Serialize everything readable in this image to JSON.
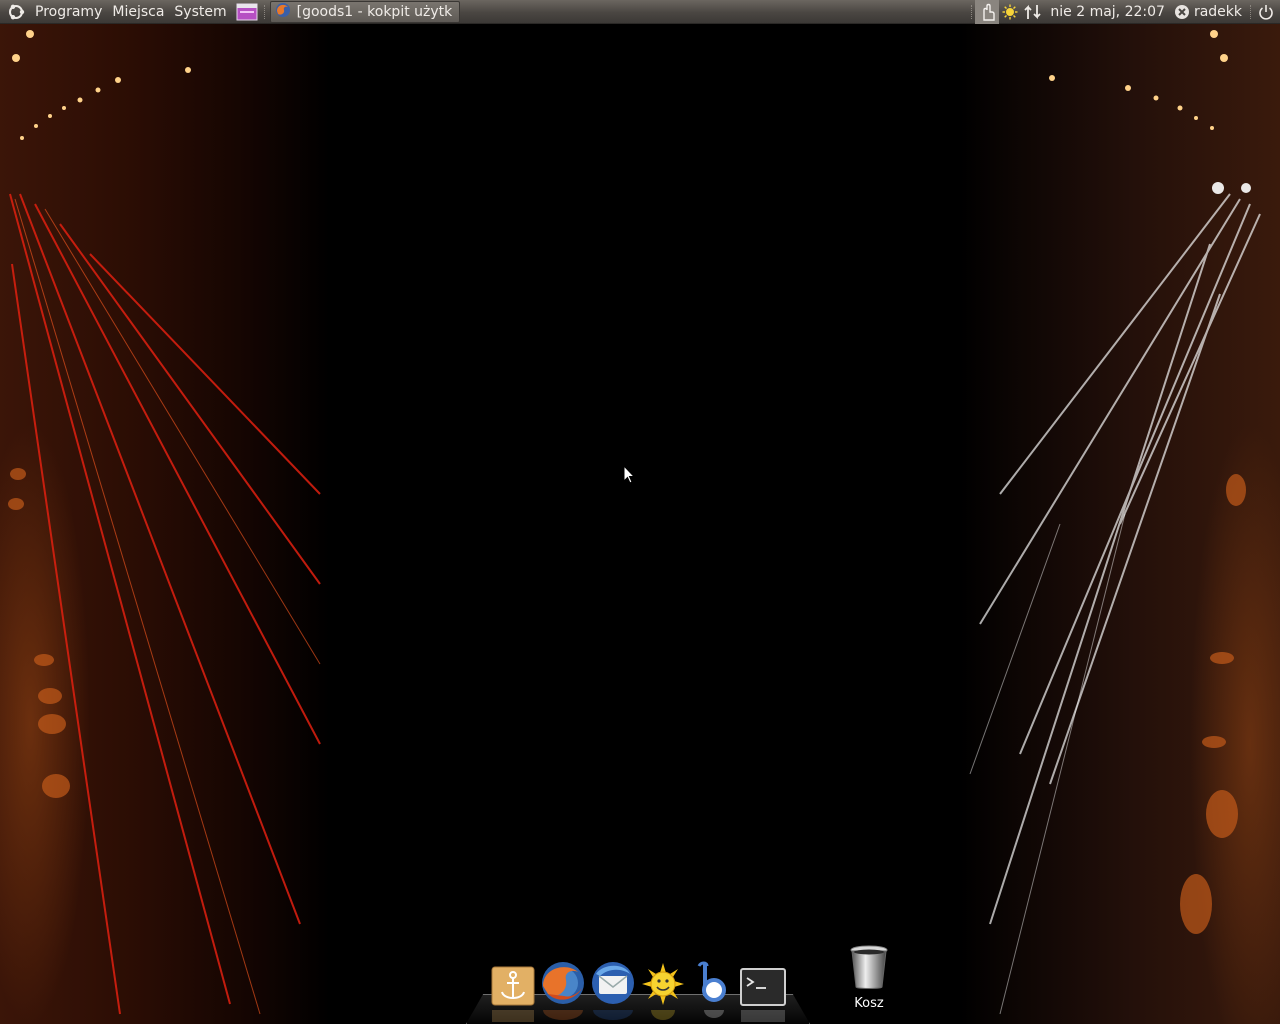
{
  "top_panel": {
    "menus": {
      "applications": "Programy",
      "places": "Miejsca",
      "system": "System"
    },
    "task": {
      "title": "[goods1 - kokpit użytk...",
      "icon": "firefox-icon"
    },
    "tray": {
      "icons": [
        "touch-icon",
        "weather-sun-icon",
        "network-updown-icon"
      ],
      "clock": "nie  2 maj, 22:07",
      "user": "radekk",
      "user_icon": "user-status-icon",
      "power_icon": "power-icon"
    }
  },
  "desktop": {
    "trash_label": "Kosz"
  },
  "dock": {
    "items": [
      {
        "icon": "anchor-icon",
        "name": "dock-anchor"
      },
      {
        "icon": "firefox-icon",
        "name": "firefox"
      },
      {
        "icon": "thunderbird-icon",
        "name": "thunderbird"
      },
      {
        "icon": "sun-smiley-icon",
        "name": "sun-app"
      },
      {
        "icon": "bluetooth-b-icon",
        "name": "b-app"
      },
      {
        "icon": "terminal-icon",
        "name": "terminal"
      }
    ]
  },
  "colors": {
    "panel": "#4a4642",
    "panel_text": "#efebe7",
    "wallpaper_left": "#3b1508",
    "wallpaper_right": "#3a1a0c"
  }
}
